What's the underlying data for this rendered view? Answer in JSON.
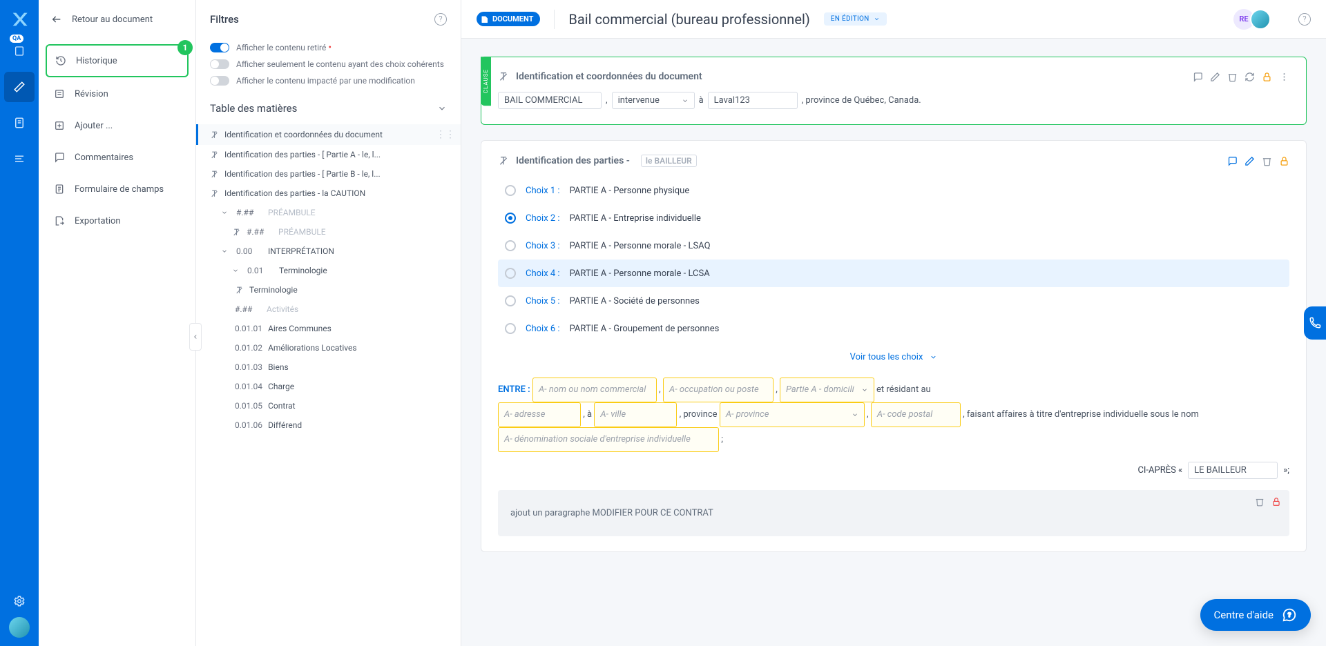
{
  "colors": {
    "primary": "#0070e0",
    "green": "#22c55e",
    "orange": "#f59e0b"
  },
  "rail": {
    "qa_badge": "QA"
  },
  "header": {
    "back_label": "Retour au document",
    "doc_chip": "DOCUMENT",
    "title": "Bail commercial (bureau professionnel)",
    "status": "EN ÉDITION",
    "user_initials": "RE"
  },
  "sidebar": {
    "items": [
      {
        "label": "Historique",
        "badge": "1",
        "highlight": true
      },
      {
        "label": "Révision"
      },
      {
        "label": "Ajouter ..."
      },
      {
        "label": "Commentaires"
      },
      {
        "label": "Formulaire de champs"
      },
      {
        "label": "Exportation"
      }
    ]
  },
  "filters": {
    "title": "Filtres",
    "rows": [
      {
        "label": "Afficher le contenu retiré",
        "on": true,
        "dot": true
      },
      {
        "label": "Afficher seulement le contenu ayant des choix cohérents",
        "on": false
      },
      {
        "label": "Afficher le contenu impacté par une modification",
        "on": false
      }
    ]
  },
  "toc": {
    "title": "Table des matières",
    "items": [
      {
        "label": "Identification et coordonnées du document",
        "icon": "x",
        "active": true,
        "drag": true
      },
      {
        "label": "Identification des parties - [ Partie A - le, l...",
        "icon": "x"
      },
      {
        "label": "Identification des parties - [ Partie B - le, l...",
        "icon": "x"
      },
      {
        "label": "Identification des parties - la CAUTION",
        "icon": "x"
      },
      {
        "num": "#.##",
        "label": "PRÉAMBULE",
        "dim": true,
        "caret": true,
        "indent": 1
      },
      {
        "num": "#.##",
        "label": "PRÉAMBULE",
        "dim": true,
        "icon": "x",
        "indent": 2
      },
      {
        "num": "0.00",
        "label": "INTERPRÉTATION",
        "caret": true,
        "indent": 1
      },
      {
        "num": "0.01",
        "label": "Terminologie",
        "caret": true,
        "indent": 2
      },
      {
        "label": "Terminologie",
        "icon": "x",
        "indent": 3
      },
      {
        "num": "#.##",
        "label": "Activités",
        "dim": true,
        "indent": 3
      },
      {
        "num": "0.01.01",
        "label": "Aires Communes",
        "indent": 3
      },
      {
        "num": "0.01.02",
        "label": "Améliorations Locatives",
        "indent": 3
      },
      {
        "num": "0.01.03",
        "label": "Biens",
        "indent": 3
      },
      {
        "num": "0.01.04",
        "label": "Charge",
        "indent": 3
      },
      {
        "num": "0.01.05",
        "label": "Contrat",
        "indent": 3
      },
      {
        "num": "0.01.06",
        "label": "Différend",
        "indent": 3
      }
    ]
  },
  "clause1": {
    "tag": "CLAUSE",
    "title": "Identification et coordonnées du document",
    "field1": "BAIL COMMERCIAL",
    "field2": "intervenue",
    "text_a": "à",
    "field3": "Laval123",
    "text_b": ", province de Québec, Canada.",
    "comma": ","
  },
  "clause2": {
    "title": "Identification des parties -",
    "chip": "le BAILLEUR",
    "choices": [
      {
        "n": "Choix 1 :",
        "t": "PARTIE A - Personne physique"
      },
      {
        "n": "Choix 2 :",
        "t": "PARTIE A - Entreprise individuelle",
        "on": true
      },
      {
        "n": "Choix 3 :",
        "t": "PARTIE A - Personne morale - LSAQ"
      },
      {
        "n": "Choix 4 :",
        "t": "PARTIE A - Personne morale - LCSA",
        "hl": true
      },
      {
        "n": "Choix 5 :",
        "t": "PARTIE A - Société de personnes"
      },
      {
        "n": "Choix 6 :",
        "t": "PARTIE A - Groupement de personnes"
      }
    ],
    "see_all": "Voir tous les choix",
    "entre": {
      "label": "ENTRE :",
      "ph_name": "A- nom ou nom commercial",
      "ph_occ": "A- occupation ou poste",
      "ph_dom": "Partie A - domicili",
      "txt1": "et résidant au",
      "ph_addr": "A- adresse",
      "txt2": ", à",
      "ph_ville": "A- ville",
      "txt3": ", province",
      "ph_prov": "A- province",
      "ph_cp": "A- code postal",
      "txt4": ", faisant affaires à titre d'entreprise individuelle sous le nom",
      "ph_denom": "A- dénomination sociale d'entreprise individuelle",
      "txt5": ";",
      "comma": ","
    },
    "ci_apres": {
      "prefix": "CI-APRÈS «",
      "field": "LE BAILLEUR",
      "suffix": "»;"
    },
    "grey": "ajout un paragraphe MODIFIER POUR CE CONTRAT"
  },
  "help": {
    "label": "Centre d'aide"
  }
}
